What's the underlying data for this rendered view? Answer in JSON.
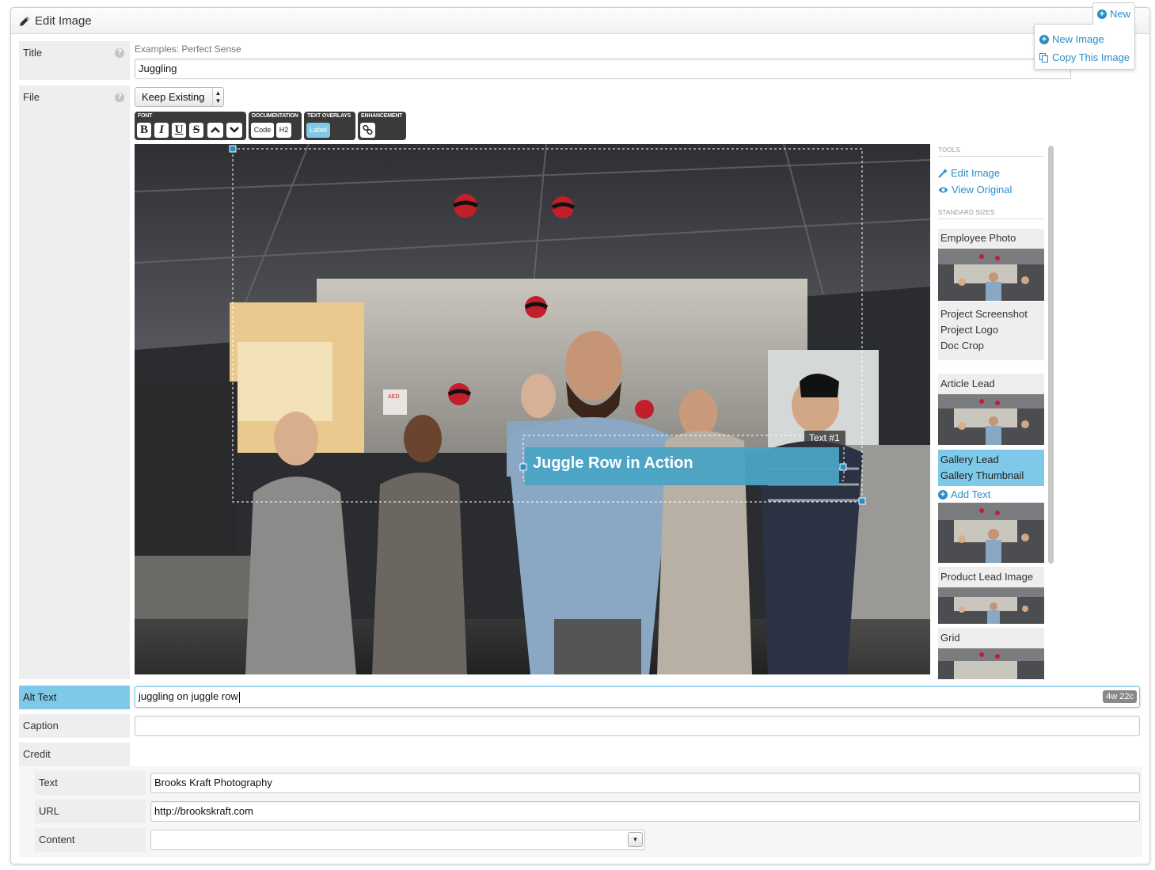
{
  "header": {
    "title": "Edit Image",
    "new_button": "New",
    "new_menu": [
      "New Image",
      "Copy This Image"
    ]
  },
  "fields": {
    "title": {
      "label": "Title",
      "hint": "Examples: Perfect Sense",
      "value": "Juggling"
    },
    "file": {
      "label": "File",
      "select_value": "Keep Existing"
    },
    "alt_text": {
      "label": "Alt Text",
      "value": "juggling on juggle row",
      "count": "4w 22c"
    },
    "caption": {
      "label": "Caption",
      "value": ""
    },
    "credit": {
      "label": "Credit",
      "text_label": "Text",
      "text_value": "Brooks Kraft Photography",
      "url_label": "URL",
      "url_value": "http://brookskraft.com",
      "content_label": "Content",
      "content_value": ""
    }
  },
  "toolbar": {
    "font": {
      "title": "FONT",
      "buttons": [
        "B",
        "I",
        "U",
        "S"
      ]
    },
    "documentation": {
      "title": "DOCUMENTATION",
      "buttons": [
        "Code",
        "H2"
      ]
    },
    "text_overlays": {
      "title": "TEXT OVERLAYS",
      "buttons": [
        "Label"
      ]
    },
    "enhancement": {
      "title": "ENHANCEMENT"
    }
  },
  "overlay": {
    "tag": "Text #1",
    "text": "Juggle Row in Action",
    "color": "#4aa3c4",
    "aed_sign": "AED"
  },
  "sidebar": {
    "tools_header": "TOOLS",
    "tools": [
      "Edit Image",
      "View Original"
    ],
    "sizes_header": "STANDARD SIZES",
    "sizes": {
      "employee_photo": "Employee Photo",
      "project_screenshot": "Project Screenshot",
      "project_logo": "Project Logo",
      "doc_crop": "Doc Crop",
      "article_lead": "Article Lead",
      "gallery_lead": "Gallery Lead",
      "gallery_thumbnail": "Gallery Thumbnail",
      "add_text": "Add Text",
      "product_lead_image": "Product Lead Image",
      "grid": "Grid"
    }
  },
  "colors": {
    "accent": "#2a8ec6",
    "selected": "#7ec8e8",
    "label_bg": "#eeeeee"
  }
}
